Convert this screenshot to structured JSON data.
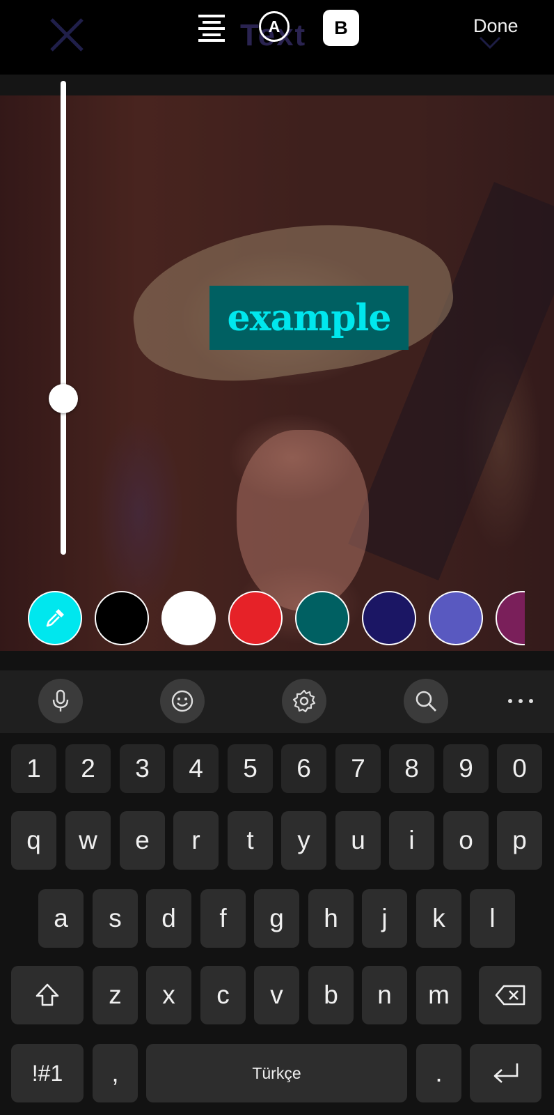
{
  "toolbar": {
    "a_badge": "A",
    "b_badge": "B",
    "done": "Done",
    "ghost_text": "Text"
  },
  "canvas": {
    "text_value": "example",
    "text_color": "#00e7ee",
    "text_background": "#006062",
    "slider_level": 0.67
  },
  "palette": [
    {
      "name": "eyedropper",
      "color": "#00e7ee"
    },
    {
      "name": "black",
      "color": "#000000"
    },
    {
      "name": "white",
      "color": "#ffffff"
    },
    {
      "name": "red",
      "color": "#e62228"
    },
    {
      "name": "teal",
      "color": "#006062"
    },
    {
      "name": "navy",
      "color": "#1b1664"
    },
    {
      "name": "indigo",
      "color": "#5959c0"
    },
    {
      "name": "plum",
      "color": "#7a1f5a"
    }
  ],
  "keyboard": {
    "toolbar_icons": [
      "microphone-icon",
      "emoji-icon",
      "gear-icon",
      "search-icon",
      "more-icon"
    ],
    "row_numbers": [
      "1",
      "2",
      "3",
      "4",
      "5",
      "6",
      "7",
      "8",
      "9",
      "0"
    ],
    "row_1": [
      "q",
      "w",
      "e",
      "r",
      "t",
      "y",
      "u",
      "i",
      "o",
      "p"
    ],
    "row_2": [
      "a",
      "s",
      "d",
      "f",
      "g",
      "h",
      "j",
      "k",
      "l"
    ],
    "row_3": [
      "z",
      "x",
      "c",
      "v",
      "b",
      "n",
      "m"
    ],
    "symbols_key": "!#1",
    "comma_key": ",",
    "space_label": "Türkçe",
    "period_key": "."
  }
}
